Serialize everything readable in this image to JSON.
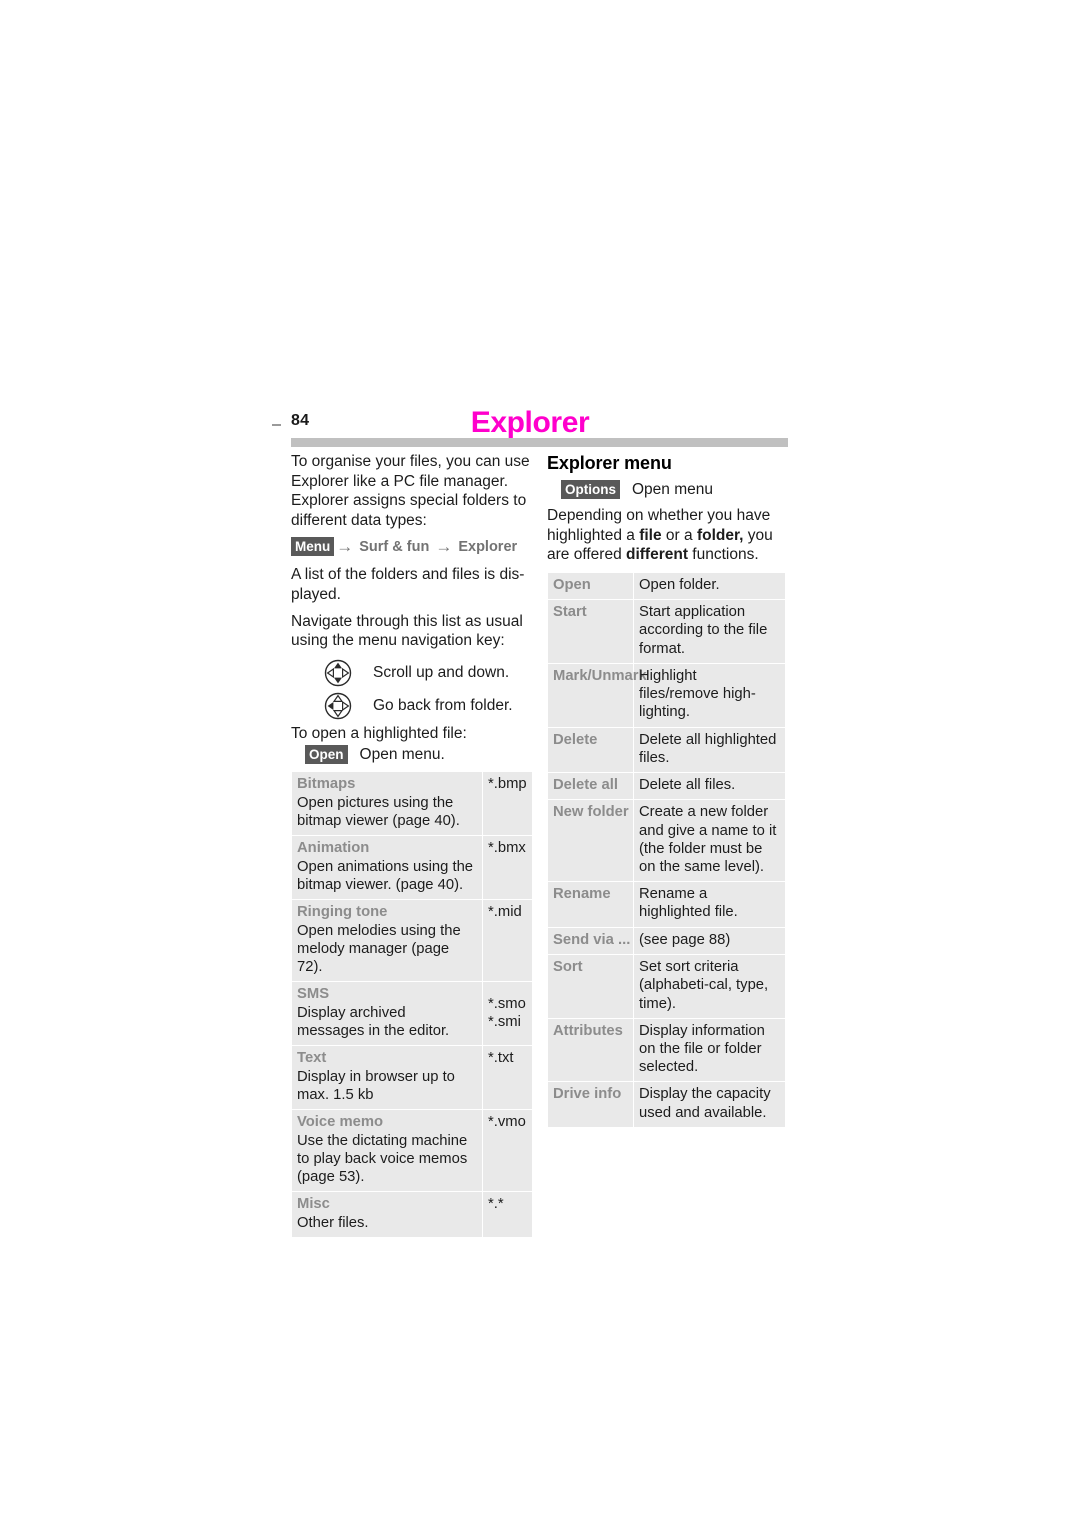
{
  "header": {
    "page_number": "84",
    "chapter_title": "Explorer",
    "title_color": "#ff00cc",
    "rule_color": "#c0c0c0"
  },
  "left_column": {
    "intro_paragraph": "To organise your files, you can use Explorer like a PC file manager. Explorer assigns special folders to different data types:",
    "menu_path": {
      "badge": "Menu",
      "step1": "Surf & fun",
      "step2": "Explorer",
      "arrow": "→"
    },
    "para_list": "A list of the folders and files is dis-played.",
    "para_navigate": "Navigate through this list as usual using the menu navigation key:",
    "nav_keys": [
      {
        "icon": "nav-key-up-down-icon",
        "label": "Scroll up and down."
      },
      {
        "icon": "nav-key-left-icon",
        "label": "Go back from folder."
      }
    ],
    "para_open": "To open a highlighted file:",
    "open_key": {
      "badge": "Open",
      "label": "Open menu."
    },
    "file_types_table": {
      "rows": [
        {
          "term": "Bitmaps",
          "desc": "Open pictures using the bitmap viewer (page 40).",
          "ext": "*.bmp"
        },
        {
          "term": "Animation",
          "desc": "Open animations using the bitmap viewer. (page 40).",
          "ext": "*.bmx"
        },
        {
          "term": "Ringing tone",
          "desc": "Open melodies using the melody manager (page 72).",
          "ext": "*.mid"
        },
        {
          "term": "SMS",
          "desc": "Display archived messages in the editor.",
          "ext": "*.smo\n*.smi",
          "ext_align": "middle"
        },
        {
          "term": "Text",
          "desc": "Display in browser up to max. 1.5 kb",
          "ext": "*.txt"
        },
        {
          "term": "Voice memo",
          "desc": "Use the dictating machine to play back voice memos (page 53).",
          "ext": "*.vmo"
        },
        {
          "term": "Misc",
          "desc": "Other files.",
          "ext": "*.*"
        }
      ]
    }
  },
  "right_column": {
    "section_title": "Explorer menu",
    "options_key": {
      "badge": "Options",
      "label": "Open menu"
    },
    "para_depending_1": "Depending on whether you have highlighted a ",
    "para_depending_bold_file": "file",
    "para_depending_2": " or a ",
    "para_depending_bold_folder": "folder,",
    "para_depending_3": " you are offered ",
    "para_depending_bold_different": "different",
    "para_depending_4": " functions.",
    "menu_table": {
      "rows": [
        {
          "term": "Open",
          "desc": "Open folder."
        },
        {
          "term": "Start",
          "desc": "Start application according to the file format."
        },
        {
          "term": "Mark/Unmark",
          "desc": "Highlight files/remove high-lighting."
        },
        {
          "term": "Delete",
          "desc": "Delete all highlighted files."
        },
        {
          "term": "Delete all",
          "desc": "Delete all files."
        },
        {
          "term": "New folder",
          "desc": "Create a new folder and give a name to it (the folder must be on the same level)."
        },
        {
          "term": "Rename",
          "desc": "Rename a highlighted file."
        },
        {
          "term": "Send via ...",
          "desc": "(see page 88)"
        },
        {
          "term": "Sort",
          "desc": "Set sort criteria (alphabeti-cal, type, time)."
        },
        {
          "term": "Attributes",
          "desc": "Display information on the file or folder selected."
        },
        {
          "term": "Drive info",
          "desc": "Display the capacity used and available."
        }
      ]
    }
  }
}
